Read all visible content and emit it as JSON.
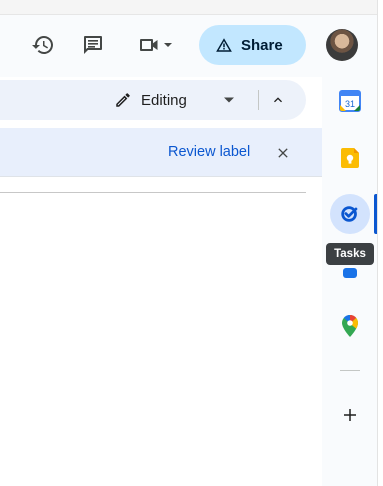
{
  "header": {
    "share_label": "Share",
    "icons": [
      "history-icon",
      "comment-icon",
      "video-call-icon",
      "chevron-down-icon",
      "lock-warning-icon"
    ]
  },
  "toolbar": {
    "mode_label": "Editing"
  },
  "banner": {
    "review_label": "Review label"
  },
  "side_panel": {
    "calendar_day": "31",
    "tooltip": "Tasks",
    "items": [
      "calendar-icon",
      "keep-icon",
      "tasks-icon",
      "contacts-icon",
      "maps-icon",
      "add-icon"
    ],
    "active_item": "tasks-icon"
  },
  "colors": {
    "share_bg": "#c2e7ff",
    "link": "#0b57d0",
    "banner_bg": "#e8effc",
    "toolbar_bg": "#edf2fa",
    "active_bg": "#d3e3fd"
  }
}
